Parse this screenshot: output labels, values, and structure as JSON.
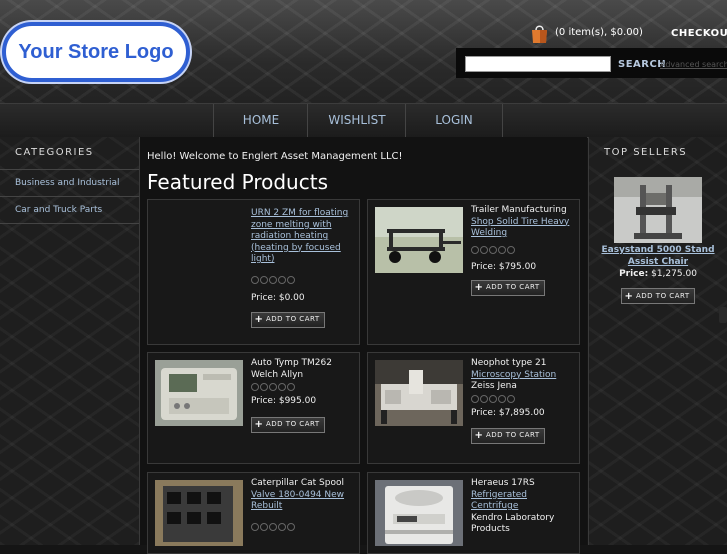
{
  "header": {
    "logo_text": "Your Store Logo",
    "cart_summary": "(0 item(s), $0.00)",
    "checkout_label": "CHECKOUT",
    "search_placeholder": "",
    "search_label": "SEARCH",
    "advanced_search_label": "Advanced search"
  },
  "nav": {
    "home": "HOME",
    "wishlist": "WISHLIST",
    "login": "LOGIN"
  },
  "left_sidebar": {
    "heading": "CATEGORIES",
    "categories": [
      "Business and Industrial",
      "Car and Truck Parts"
    ]
  },
  "main": {
    "welcome": "Hello! Welcome to Englert Asset Management LLC!",
    "featured_title": "Featured Products",
    "add_to_cart_label": "ADD TO CART",
    "products": [
      {
        "name": "URN 2 ZM for floating zone melting with radiation heating (heating by focused light)",
        "manufacturer": "",
        "price": "Price: $0.00",
        "rating_stars": 0
      },
      {
        "name": "Trailer Manufacturing Shop Solid Tire Heavy Welding",
        "name_plain_part": "Trailer Manufacturing",
        "name_link_part": "Shop Solid Tire Heavy Welding",
        "manufacturer": "",
        "price": "Price: $795.00",
        "rating_stars": 0
      },
      {
        "name": "Auto Tymp TM262",
        "manufacturer": "Welch Allyn",
        "price": "Price: $995.00",
        "rating_stars": 0
      },
      {
        "name": "Neophot type 21 Microscopy Station",
        "name_plain_part": "Neophot type 21",
        "name_link_part": "Microscopy Station",
        "manufacturer": "Zeiss Jena",
        "price": "Price: $7,895.00",
        "rating_stars": 0
      },
      {
        "name": "Caterpillar Cat Spool Valve 180-0494 New Rebuilt",
        "name_plain_part": "Caterpillar Cat Spool",
        "name_link_part": "Valve 180-0494 New Rebuilt",
        "manufacturer": "",
        "price": "",
        "rating_stars": 0
      },
      {
        "name": "Heraeus 17RS Refrigerated Centrifuge",
        "name_plain_part": "Heraeus 17RS",
        "name_link_part": "Refrigerated Centrifuge",
        "manufacturer": "Kendro Laboratory Products",
        "price": "",
        "rating_stars": 0
      }
    ]
  },
  "right_sidebar": {
    "heading": "TOP SELLERS",
    "top_seller": {
      "name": "Easystand 5000 Stand Assist Chair",
      "price_label": "Price:",
      "price_value": "$1,275.00"
    }
  },
  "colors": {
    "logo_blue": "#2f5fd2",
    "link_blue": "#a8c0da",
    "cart_orange": "#e07a2e"
  },
  "icons": [
    "shopping-bag-icon",
    "plus-icon",
    "star-icon"
  ]
}
